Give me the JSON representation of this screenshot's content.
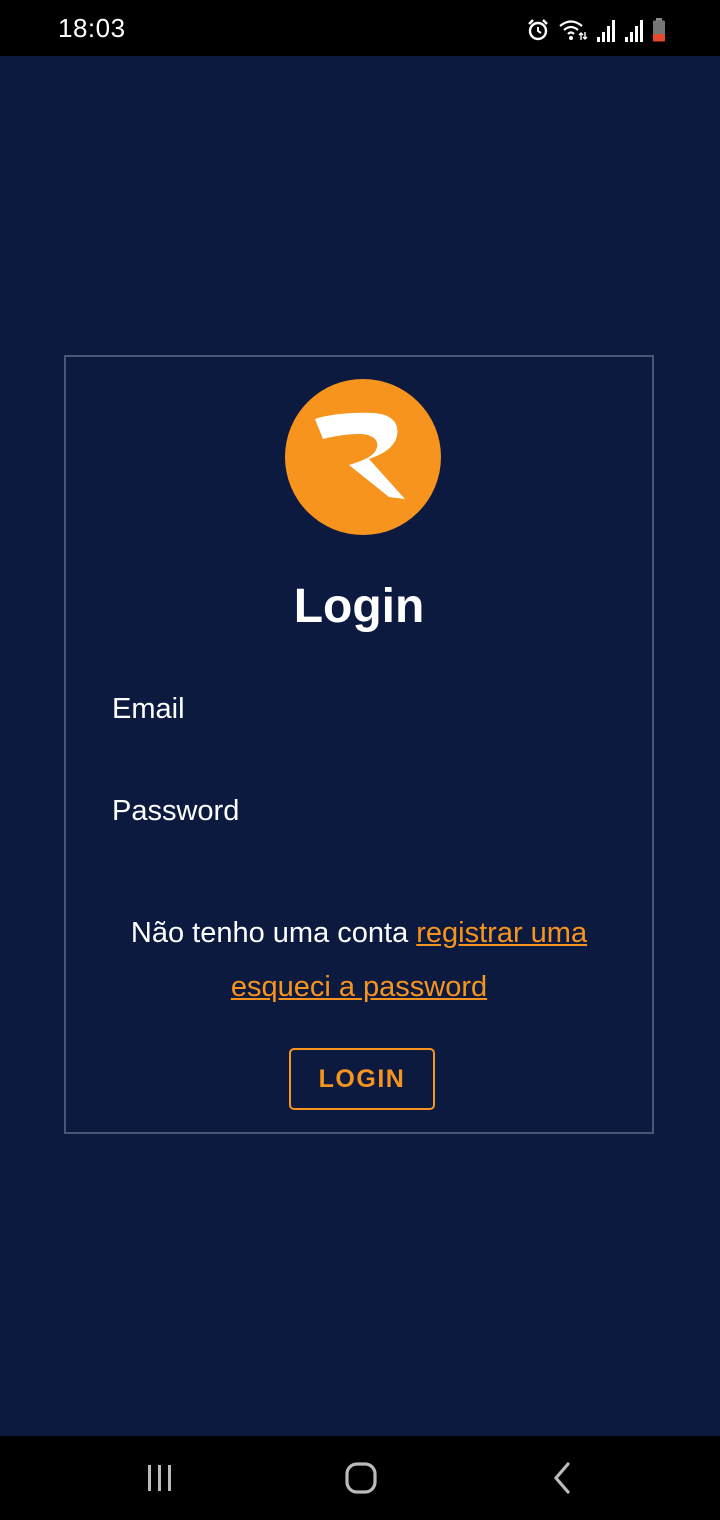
{
  "status_bar": {
    "time": "18:03",
    "icons": [
      "alarm-icon",
      "wifi-icon",
      "signal-icon",
      "signal-icon",
      "battery-icon"
    ]
  },
  "login": {
    "logo_icon": "app-logo-r",
    "title": "Login",
    "email_placeholder": "Email",
    "password_placeholder": "Password",
    "no_account_text": "Não tenho uma conta ",
    "register_link": "registrar uma",
    "forgot_link": "esqueci a password",
    "login_button": "LOGIN"
  },
  "nav_bar": {
    "icons": [
      "recents-icon",
      "home-icon",
      "back-icon"
    ]
  },
  "colors": {
    "background": "#0d1a40",
    "accent": "#f7941d",
    "card_border": "#4a5878",
    "text": "#ffffff"
  }
}
